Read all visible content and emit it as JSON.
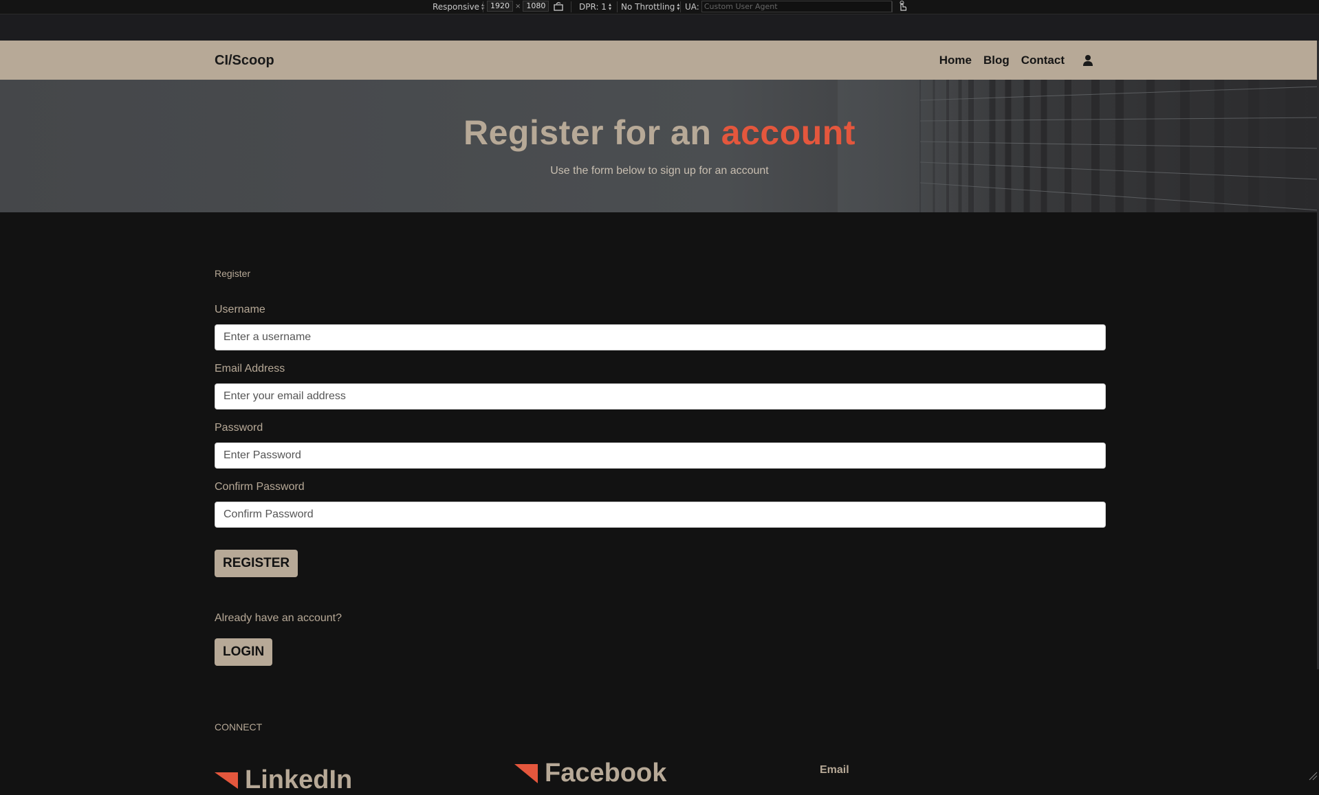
{
  "devtools": {
    "device_mode": "Responsive",
    "width": "1920",
    "times": "×",
    "height": "1080",
    "dpr": "DPR: 1",
    "throttling": "No Throttling",
    "ua_label": "UA:",
    "ua_placeholder": "Custom User Agent"
  },
  "navbar": {
    "brand": "CI/Scoop",
    "links": [
      "Home",
      "Blog",
      "Contact"
    ]
  },
  "hero": {
    "title_part1": "Register for an",
    "title_accent": "account",
    "subtitle": "Use the form below to sign up for an account"
  },
  "form": {
    "caption": "Register",
    "fields": [
      {
        "label": "Username",
        "placeholder": "Enter a username"
      },
      {
        "label": "Email Address",
        "placeholder": "Enter your email address"
      },
      {
        "label": "Password",
        "placeholder": "Enter Password"
      },
      {
        "label": "Confirm Password",
        "placeholder": "Confirm Password"
      }
    ],
    "submit_label": "REGISTER",
    "already_text": "Already have an account?",
    "login_label": "LOGIN"
  },
  "footer": {
    "connect_title": "CONNECT",
    "socials": [
      "LinkedIn",
      "Facebook"
    ],
    "email_label": "Email"
  },
  "colors": {
    "beige": "#b7a997",
    "accent": "#e4573d",
    "background": "#121212"
  }
}
